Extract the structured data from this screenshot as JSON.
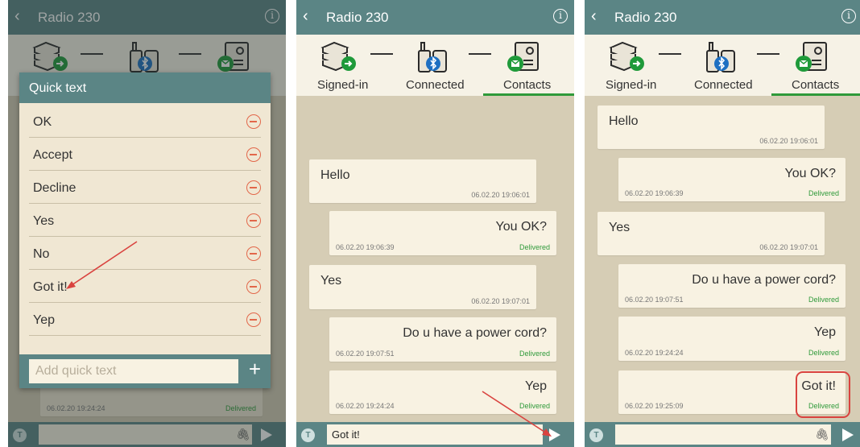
{
  "header": {
    "back_glyph": "‹",
    "title": "Radio 230",
    "info_glyph": "i"
  },
  "tabs": {
    "signed_in": "Signed-in",
    "connected": "Connected",
    "contacts": "Contacts"
  },
  "icons": {
    "signed_in": "server-stack-icon",
    "connected": "radio-bluetooth-icon",
    "contacts": "contact-card-mail-icon"
  },
  "colors": {
    "header": "#5b8585",
    "accent_green": "#2f9a3a",
    "chat_bg": "#d6cdb5",
    "bubble": "#f8f2e2",
    "remove": "#e2674a",
    "annotation_red": "#d9433f"
  },
  "quick_text": {
    "title": "Quick text",
    "items": [
      "OK",
      "Accept",
      "Decline",
      "Yes",
      "No",
      "Got it!",
      "Yep"
    ],
    "add_placeholder": "Add quick text",
    "add_glyph": "+"
  },
  "panel1_bg": {
    "timestamp": "06.02.20 19:24:24",
    "status": "Delivered"
  },
  "panel2": {
    "messages": [
      {
        "dir": "in",
        "text": "Hello",
        "time": "06.02.20 19:06:01"
      },
      {
        "dir": "out",
        "text": "You OK?",
        "time": "06.02.20 19:06:39",
        "status": "Delivered"
      },
      {
        "dir": "in",
        "text": "Yes",
        "time": "06.02.20 19:07:01"
      },
      {
        "dir": "out",
        "text": "Do u have a power cord?",
        "time": "06.02.20 19:07:51",
        "status": "Delivered"
      },
      {
        "dir": "out",
        "text": "Yep",
        "time": "06.02.20 19:24:24",
        "status": "Delivered"
      }
    ],
    "input_value": "Got it!"
  },
  "panel3": {
    "messages": [
      {
        "dir": "in",
        "text": "Hello",
        "time": "06.02.20 19:06:01"
      },
      {
        "dir": "out",
        "text": "You OK?",
        "time": "06.02.20 19:06:39",
        "status": "Delivered"
      },
      {
        "dir": "in",
        "text": "Yes",
        "time": "06.02.20 19:07:01"
      },
      {
        "dir": "out",
        "text": "Do u have a power cord?",
        "time": "06.02.20 19:07:51",
        "status": "Delivered"
      },
      {
        "dir": "out",
        "text": "Yep",
        "time": "06.02.20 19:24:24",
        "status": "Delivered"
      },
      {
        "dir": "out",
        "text": "Got it!",
        "time": "06.02.20 19:25:09",
        "status": "Delivered"
      }
    ],
    "input_value": ""
  },
  "bottom": {
    "t_label": "T",
    "attach_glyph": "🖇"
  }
}
